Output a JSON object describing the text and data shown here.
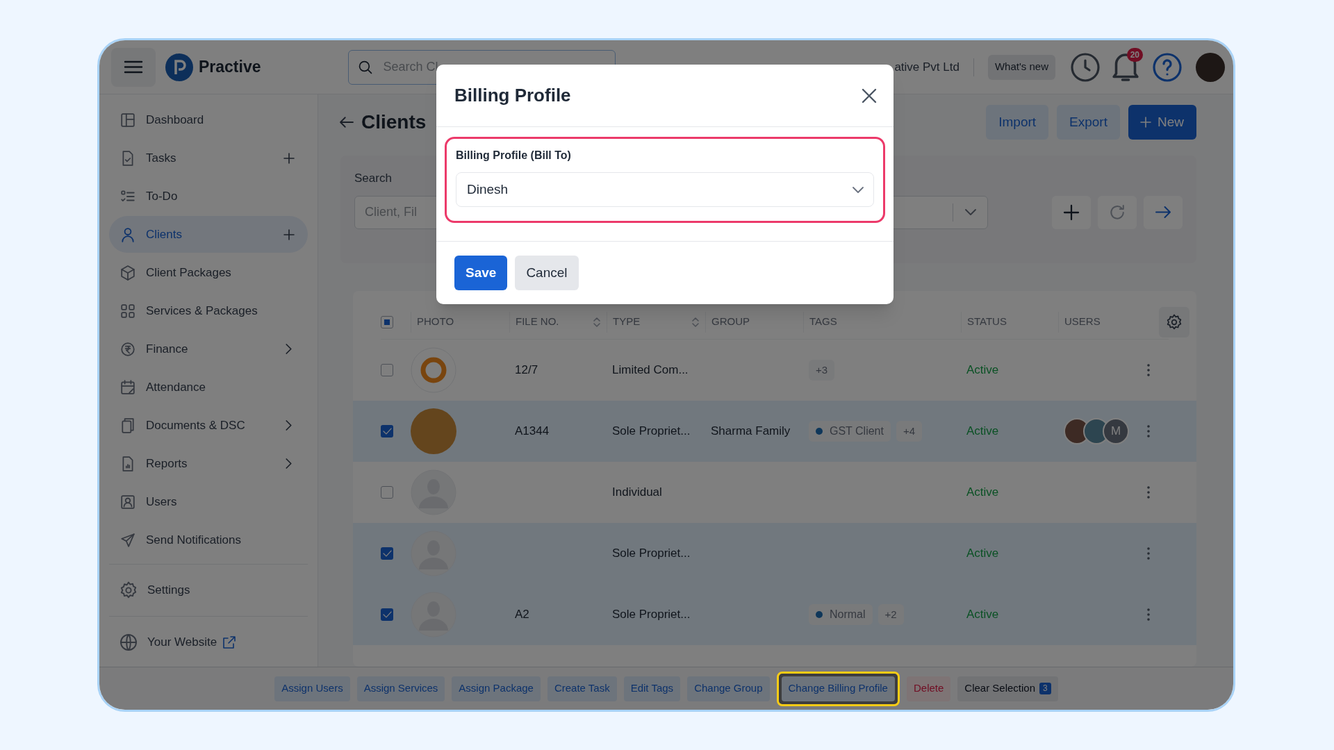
{
  "header": {
    "brand": "Practive",
    "search": {
      "placeholder": "Search Cl"
    },
    "company": "ative Pvt Ltd",
    "whats_new": "What's new",
    "notification_count": "20"
  },
  "sidebar": {
    "items": [
      {
        "label": "Dashboard",
        "selected": false,
        "kind": "plain"
      },
      {
        "label": "Tasks",
        "selected": false,
        "kind": "addable"
      },
      {
        "label": "To-Do",
        "selected": false,
        "kind": "plain"
      },
      {
        "label": "Clients",
        "selected": true,
        "kind": "addable"
      },
      {
        "label": "Client Packages",
        "selected": false,
        "kind": "plain"
      },
      {
        "label": "Services & Packages",
        "selected": false,
        "kind": "plain"
      },
      {
        "label": "Finance",
        "selected": false,
        "kind": "submenu"
      },
      {
        "label": "Attendance",
        "selected": false,
        "kind": "plain"
      },
      {
        "label": "Documents & DSC",
        "selected": false,
        "kind": "submenu"
      },
      {
        "label": "Reports",
        "selected": false,
        "kind": "submenu"
      },
      {
        "label": "Users",
        "selected": false,
        "kind": "plain"
      },
      {
        "label": "Send Notifications",
        "selected": false,
        "kind": "plain"
      }
    ],
    "settings": "Settings",
    "website": "Your Website"
  },
  "page": {
    "title": "Clients",
    "buttons": [
      {
        "label": "Import",
        "kind": "soft"
      },
      {
        "label": "Export",
        "kind": "soft"
      },
      {
        "label": "New",
        "kind": "primary"
      }
    ]
  },
  "filters": {
    "label": "Search",
    "placeholder": "Client, Fil"
  },
  "table": {
    "select_all": {
      "checked": true,
      "partial": true
    },
    "columns": [
      {
        "label": "PHOTO",
        "sortable": false
      },
      {
        "label": "FILE NO.",
        "sortable": true
      },
      {
        "label": "TYPE",
        "sortable": true
      },
      {
        "label": "GROUP",
        "sortable": false
      },
      {
        "label": "TAGS",
        "sortable": false
      },
      {
        "label": "STATUS",
        "sortable": false
      },
      {
        "label": "USERS",
        "sortable": false
      }
    ],
    "rows": [
      {
        "selected": false,
        "photo": {
          "kind": "logo"
        },
        "file_no": "12/7",
        "type": "Limited Com...",
        "tags": [],
        "more_tags": "+3",
        "status": "Active",
        "users": []
      },
      {
        "selected": true,
        "photo": {
          "kind": "photo"
        },
        "file_no": "A1344",
        "type": "Sole Propriet...",
        "group": "Sharma Family",
        "tags": [
          "GST Client"
        ],
        "more_tags": "+4",
        "status": "Active",
        "users": [
          {
            "kind": "photo"
          },
          {
            "kind": "photo"
          },
          {
            "kind": "initial",
            "text": "M"
          }
        ]
      },
      {
        "selected": false,
        "photo": {
          "kind": "default"
        },
        "type": "Individual",
        "tags": [],
        "status": "Active",
        "users": []
      },
      {
        "selected": true,
        "photo": {
          "kind": "default"
        },
        "type": "Sole Propriet...",
        "tags": [],
        "status": "Active",
        "users": []
      },
      {
        "selected": true,
        "photo": {
          "kind": "default"
        },
        "file_no": "A2",
        "type": "Sole Propriet...",
        "tags": [
          "Normal"
        ],
        "more_tags": "+2",
        "status": "Active",
        "users": []
      }
    ]
  },
  "bulk_actions": [
    {
      "label": "Assign Users",
      "kind": "normal",
      "highlighted": false
    },
    {
      "label": "Assign Services",
      "kind": "normal",
      "highlighted": false
    },
    {
      "label": "Assign Package",
      "kind": "normal",
      "highlighted": false
    },
    {
      "label": "Create Task",
      "kind": "normal",
      "highlighted": false
    },
    {
      "label": "Edit Tags",
      "kind": "normal",
      "highlighted": false
    },
    {
      "label": "Change Group",
      "kind": "normal",
      "highlighted": false
    },
    {
      "label": "Change Billing Profile",
      "kind": "normal",
      "highlighted": true
    },
    {
      "label": "Delete",
      "kind": "danger",
      "highlighted": false
    },
    {
      "label": "Clear Selection",
      "kind": "clear",
      "highlighted": false,
      "count": "3"
    }
  ],
  "modal": {
    "title": "Billing Profile",
    "field": {
      "label": "Billing Profile (Bill To)",
      "value": "Dinesh",
      "highlighted": true
    },
    "buttons": [
      {
        "label": "Save",
        "kind": "primary"
      },
      {
        "label": "Cancel",
        "kind": "secondary"
      }
    ]
  }
}
